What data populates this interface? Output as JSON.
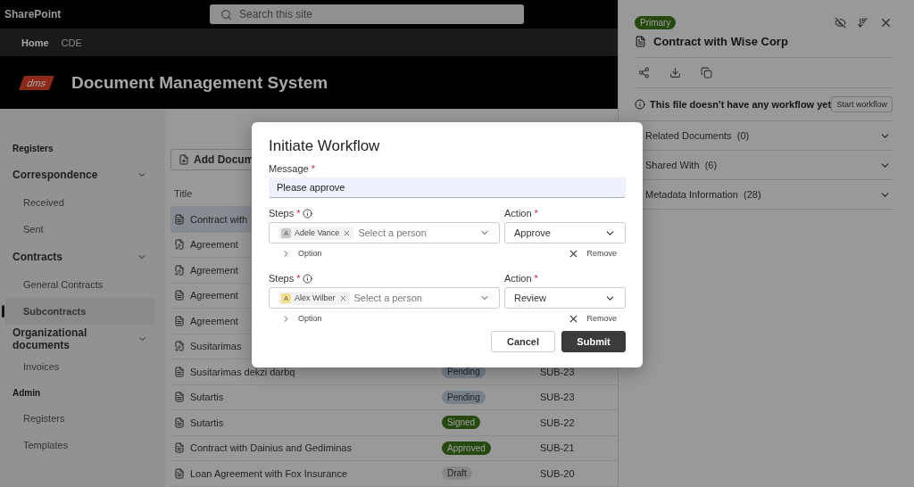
{
  "site": {
    "name": "SharePoint",
    "search_placeholder": "Search this site"
  },
  "nav": [
    {
      "label": "Home",
      "selected": true
    },
    {
      "label": "CDE",
      "selected": false
    }
  ],
  "banner": {
    "logo": "dms",
    "title": "Document Management System"
  },
  "sidebar": [
    {
      "title": "Registers",
      "groups": [
        {
          "label": "Correspondence",
          "expanded": true,
          "children": [
            {
              "label": "Received",
              "selected": false
            },
            {
              "label": "Sent",
              "selected": false
            }
          ]
        },
        {
          "label": "Contracts",
          "expanded": true,
          "children": [
            {
              "label": "General Contracts",
              "selected": false
            },
            {
              "label": "Subcontracts",
              "selected": true
            }
          ]
        },
        {
          "label": "Organizational documents",
          "expanded": true,
          "children": [
            {
              "label": "Invoices",
              "selected": false
            }
          ]
        }
      ]
    },
    {
      "title": "Admin",
      "groups": [
        {
          "label": "Registers",
          "selected": false
        },
        {
          "label": "Templates",
          "selected": false
        }
      ]
    }
  ],
  "toolbar": {
    "add_button": "Add Docum"
  },
  "table": {
    "columns": [
      "Title"
    ],
    "rows": [
      {
        "kind": "file",
        "title": "Contract with",
        "selected": true
      },
      {
        "kind": "signing",
        "title": "Agreement",
        "selected": false
      },
      {
        "kind": "signing",
        "title": "Agreement",
        "selected": false
      },
      {
        "kind": "file",
        "title": "Agreement",
        "selected": false
      },
      {
        "kind": "file",
        "title": "Agreement",
        "selected": false
      },
      {
        "kind": "signing",
        "title": "Susitarimas",
        "selected": false
      },
      {
        "kind": "file",
        "title": "Susitarimas dekzi darbq",
        "status": {
          "label": "Pending",
          "color": "#778088"
        },
        "id": "SUB-23",
        "selected": false
      },
      {
        "kind": "file",
        "title": "Sutartis",
        "status": {
          "label": "Pending",
          "color": "#778088"
        },
        "id": "SUB-23",
        "selected": false
      },
      {
        "kind": "file",
        "title": "Sutartis",
        "status": {
          "label": "Signed",
          "color": "#264910"
        },
        "id": "SUB-22",
        "selected": false
      },
      {
        "kind": "file",
        "title": "Contract with Dainius and Gediminas",
        "status": {
          "label": "Approved",
          "color": "#264910"
        },
        "id": "SUB-21",
        "selected": false
      },
      {
        "kind": "file",
        "title": "Loan Agreement with Fox Insurance",
        "status": {
          "label": "Draft",
          "color": "#878787"
        },
        "id": "SUB-20",
        "selected": false
      }
    ]
  },
  "details": {
    "badge": "Primary",
    "title": "Contract with Wise Corp",
    "notice": "This file doesn't have any workflow yet",
    "start_button": "Start workflow",
    "sections": [
      {
        "label": "Related Documents",
        "count": "(0)",
        "expanded": false
      },
      {
        "label": "Shared With",
        "count": "(6)",
        "expanded": false
      },
      {
        "label": "Metadata Information",
        "count": "(28)",
        "expanded": false
      }
    ]
  },
  "dialog": {
    "title": "Initiate Workflow",
    "message_label": "Message",
    "message_required": "*",
    "message_value": "Please approve",
    "steps": [
      {
        "label": "Steps",
        "required": "*",
        "person": {
          "initial": "A",
          "name": "Adele Vance",
          "color": "#c8c8c8"
        },
        "placeholder": "Select a person",
        "action_label": "Action",
        "action_required": "*",
        "action": "Approve",
        "option": "Option",
        "remove": "Remove"
      },
      {
        "label": "Steps",
        "required": "*",
        "person": {
          "initial": "A",
          "name": "Alex Wilber",
          "color": "#f1df8c"
        },
        "placeholder": "Select a person",
        "action_label": "Action",
        "action_required": "*",
        "action": "Review",
        "option": "Option",
        "remove": "Remove"
      }
    ],
    "cancel": "Cancel",
    "submit": "Submit"
  }
}
